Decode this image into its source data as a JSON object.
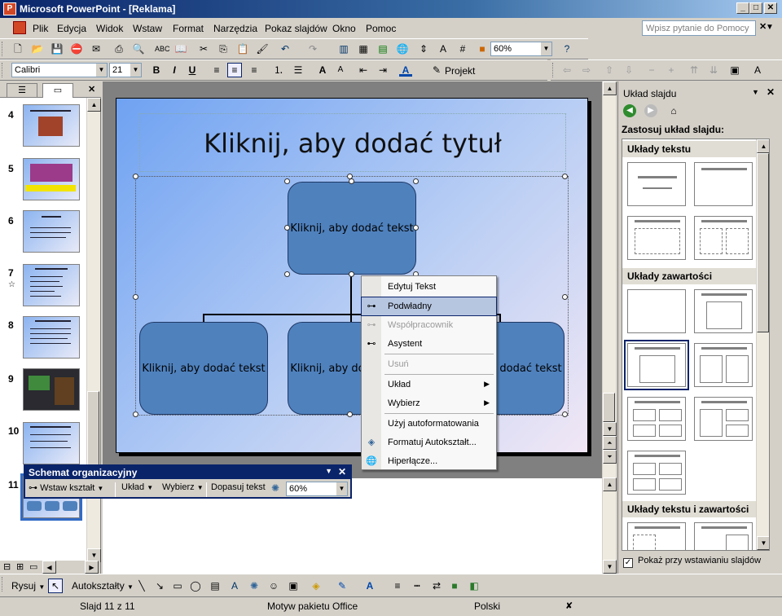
{
  "window": {
    "title": "Microsoft PowerPoint - [Reklama]"
  },
  "menu": [
    "Plik",
    "Edycja",
    "Widok",
    "Wstaw",
    "Format",
    "Narzędzia",
    "Pokaz slajdów",
    "Okno",
    "Pomoc"
  ],
  "help_placeholder": "Wpisz pytanie do Pomocy",
  "standard_toolbar": {
    "zoom": "60%"
  },
  "formatting_toolbar": {
    "font": "Calibri",
    "size": "21",
    "design_label": "Projekt"
  },
  "slides": [
    {
      "num": "4"
    },
    {
      "num": "5"
    },
    {
      "num": "6"
    },
    {
      "num": "7"
    },
    {
      "num": "8"
    },
    {
      "num": "9"
    },
    {
      "num": "10"
    },
    {
      "num": "11"
    }
  ],
  "slide": {
    "title_placeholder": "Kliknij, aby dodać tytuł",
    "box_top": "Kliknij, aby dodać tekst",
    "box_left": "Kliknij, aby dodać tekst",
    "box_mid": "Kliknij, aby dodać tekst",
    "box_right": "Kliknij, aby dodać tekst"
  },
  "context_menu": [
    {
      "label": "Edytuj Tekst",
      "disabled": false
    },
    {
      "label": "Podwładny",
      "disabled": false
    },
    {
      "label": "Współpracownik",
      "disabled": true
    },
    {
      "label": "Asystent",
      "disabled": false
    },
    {
      "label": "Usuń",
      "disabled": true
    },
    {
      "label": "Układ",
      "disabled": false
    },
    {
      "label": "Wybierz",
      "disabled": false
    },
    {
      "label": "Użyj autoformatowania",
      "disabled": false
    },
    {
      "label": "Formatuj Autokształt...",
      "disabled": false
    },
    {
      "label": "Hiperłącze...",
      "disabled": false
    }
  ],
  "org_toolbar": {
    "title": "Schemat organizacyjny",
    "insert_shape": "Wstaw kształt",
    "layout": "Układ",
    "select": "Wybierz",
    "fit_text": "Dopasuj tekst",
    "zoom": "60%"
  },
  "task_pane": {
    "title": "Układ slajdu",
    "apply_label": "Zastosuj układ slajdu:",
    "section_text": "Układy tekstu",
    "section_content": "Układy zawartości",
    "section_text_content": "Układy tekstu i zawartości",
    "show_on_insert": "Pokaż przy wstawianiu slajdów"
  },
  "drawing_toolbar": {
    "draw": "Rysuj",
    "autoshapes": "Autokształty"
  },
  "status": {
    "slide": "Slajd 11 z 11",
    "theme": "Motyw pakietu Office",
    "language": "Polski"
  }
}
